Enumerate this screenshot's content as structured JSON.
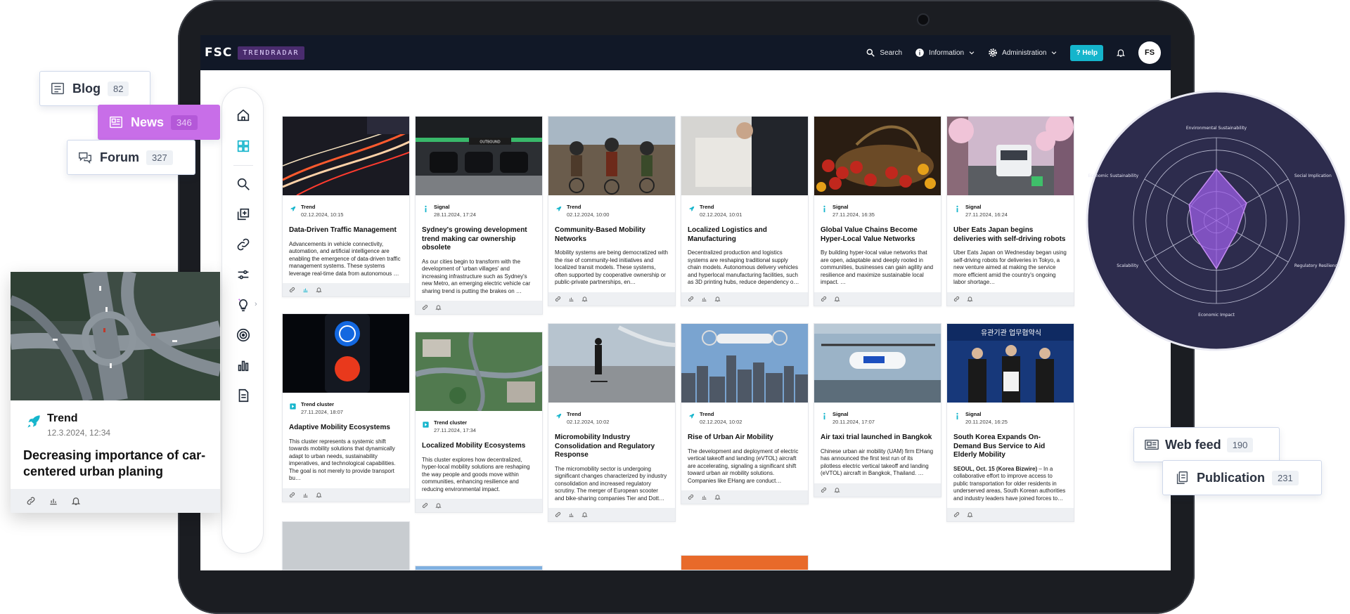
{
  "app": {
    "logo": "FSC",
    "product": "TRENDRADAR"
  },
  "navbar": {
    "search": "Search",
    "information": "Information",
    "administration": "Administration",
    "help": "Help",
    "avatar": "FS"
  },
  "chips": {
    "blog": {
      "label": "Blog",
      "count": "82"
    },
    "news": {
      "label": "News",
      "count": "346"
    },
    "forum": {
      "label": "Forum",
      "count": "327"
    },
    "webfeed": {
      "label": "Web feed",
      "count": "190"
    },
    "publication": {
      "label": "Publication",
      "count": "231"
    }
  },
  "float_card": {
    "type": "Trend",
    "date": "12.3.2024, 12:34",
    "title": "Decreasing importance of car-centered urban planing"
  },
  "cards": [
    {
      "type": "Trend",
      "date": "02.12.2024, 10:15",
      "title": "Data-Driven Traffic Management",
      "desc": "Advancements in vehicle connectivity, automation, and artificial intelligence are enabling the emergence of data-driven traffic management systems. These systems leverage real-time data from autonomous …"
    },
    {
      "type": "Signal",
      "date": "28.11.2024, 17:24",
      "title": "Sydney's growing development trend making car ownership obsolete",
      "desc": "As our cities begin to transform with the development of 'urban villages' and increasing infrastructure such as Sydney's new Metro, an emerging electric vehicle car sharing trend is putting the brakes on …",
      "image_text": "OUTBOUND"
    },
    {
      "type": "Trend",
      "date": "02.12.2024, 10:00",
      "title": "Community-Based Mobility Networks",
      "desc": "Mobility systems are being democratized with the rise of community-led initiatives and localized transit models. These systems, often supported by cooperative ownership or public-private partnerships, en…"
    },
    {
      "type": "Trend",
      "date": "02.12.2024, 10:01",
      "title": "Localized Logistics and Manufacturing",
      "desc": "Decentralized production and logistics systems are reshaping traditional supply chain models. Autonomous delivery vehicles and hyperlocal manufacturing facilities, such as 3D printing hubs, reduce dependency o…"
    },
    {
      "type": "Signal",
      "date": "27.11.2024, 16:35",
      "title": "Global Value Chains Become Hyper-Local Value Networks",
      "desc": "By building hyper-local value networks that are open, adaptable and deeply rooted in communities, businesses can gain agility and resilience and maximize sustainable local impact. …"
    },
    {
      "type": "Signal",
      "date": "27.11.2024, 16:24",
      "title": "Uber Eats Japan begins deliveries with self-driving robots",
      "desc": "Uber Eats Japan on Wednesday began using self-driving robots for deliveries in Tokyo, a new venture aimed at making the service more efficient amid the country's ongoing labor shortage…"
    },
    {
      "type": "Trend cluster",
      "date": "27.11.2024, 18:07",
      "title": "Adaptive Mobility Ecosystems",
      "desc": "This cluster represents a systemic shift towards mobility solutions that dynamically adapt to urban needs, sustainability imperatives, and technological capabilities. The goal is not merely to provide transport bu…"
    },
    {
      "type": "Trend cluster",
      "date": "27.11.2024, 17:34",
      "title": "Localized Mobility Ecosystems",
      "desc": "This cluster explores how decentralized, hyper-local mobility solutions are reshaping the way people and goods move within communities, enhancing resilience and reducing environmental impact."
    },
    {
      "type": "Trend",
      "date": "02.12.2024, 10:02",
      "title": "Micromobility Industry Consolidation and Regulatory Response",
      "desc": "The micromobility sector is undergoing significant changes characterized by industry consolidation and increased regulatory scrutiny. The merger of European scooter and bike-sharing companies Tier and Dott…"
    },
    {
      "type": "Trend",
      "date": "02.12.2024, 10:02",
      "title": "Rise of Urban Air Mobility",
      "desc": "The development and deployment of electric vertical takeoff and landing (eVTOL) aircraft are accelerating, signaling a significant shift toward urban air mobility solutions. Companies like EHang are conduct…"
    },
    {
      "type": "Signal",
      "date": "20.11.2024, 17:07",
      "title": "Air taxi trial launched in Bangkok",
      "desc": "Chinese urban air mobility (UAM) firm EHang has announced the first test run of its pilotless electric vertical takeoff and landing (eVTOL) aircraft in Bangkok, Thailand. …"
    },
    {
      "type": "Signal",
      "date": "20.11.2024, 16:25",
      "title": "South Korea Expands On-Demand Bus Service to Aid Elderly Mobility",
      "desc_lead": "SEOUL, Oct. 15 (Korea Bizwire)",
      "desc": " – In a collaborative effort to improve access to public transportation for older residents in underserved areas, South Korean authorities and industry leaders have joined forces to…",
      "image_text": "유관기관 업무협약식"
    }
  ],
  "radar": {
    "axes": [
      "Environmental Sustainability",
      "Social Implication",
      "Regulatory Resilience",
      "Economic Impact",
      "Scalability",
      "Economic Sustainability"
    ],
    "values": [
      0.62,
      0.42,
      0.28,
      0.58,
      0.32,
      0.38
    ]
  },
  "colors": {
    "accent_cyan": "#15b5cc",
    "accent_purple": "#c86ee8",
    "navbar": "#111827",
    "radar_bg": "#2d2c4d",
    "radar_fill": "#9b5de5"
  }
}
